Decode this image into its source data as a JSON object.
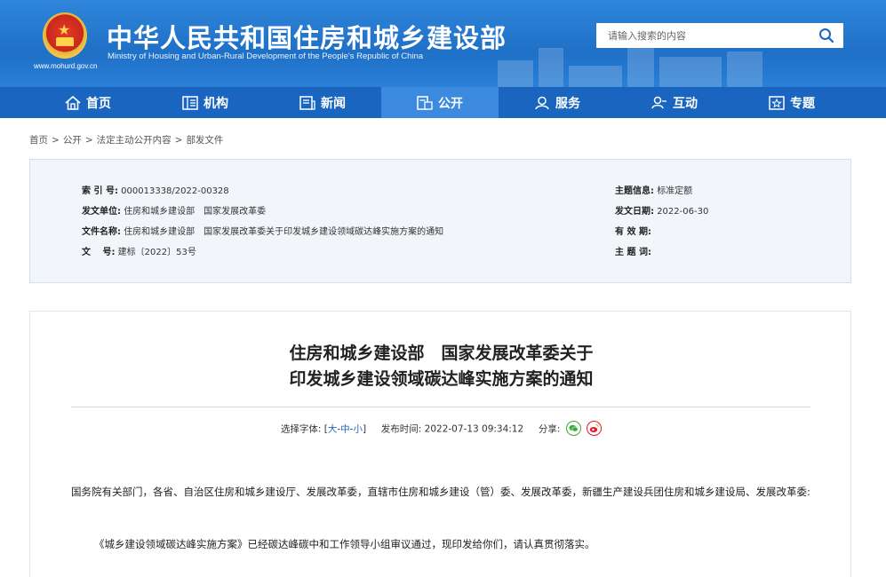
{
  "header": {
    "title_cn": "中华人民共和国住房和城乡建设部",
    "title_en": "Ministry of Housing and Urban-Rural Development of the People's Republic of China",
    "site_url": "www.mohurd.gov.cn",
    "search_placeholder": "请输入搜索的内容"
  },
  "nav": {
    "items": [
      {
        "label": "首页",
        "icon": "home-icon"
      },
      {
        "label": "机构",
        "icon": "building-icon"
      },
      {
        "label": "新闻",
        "icon": "news-icon"
      },
      {
        "label": "公开",
        "icon": "disclosure-icon"
      },
      {
        "label": "服务",
        "icon": "service-icon"
      },
      {
        "label": "互动",
        "icon": "interaction-icon"
      },
      {
        "label": "专题",
        "icon": "topic-icon"
      }
    ],
    "active_index": 3
  },
  "breadcrumb": [
    "首页",
    "公开",
    "法定主动公开内容",
    "部发文件"
  ],
  "info": {
    "index_label": "索 引 号:",
    "index_value": "000013338/2022-00328",
    "unit_label": "发文单位:",
    "unit_value": "住房和城乡建设部　国家发展改革委",
    "name_label": "文件名称:",
    "name_value": "住房和城乡建设部　国家发展改革委关于印发城乡建设领域碳达峰实施方案的通知",
    "docno_label": "文　 号:",
    "docno_value": "建标〔2022〕53号",
    "topic_label": "主题信息:",
    "topic_value": "标准定额",
    "date_label": "发文日期:",
    "date_value": "2022-06-30",
    "valid_label": "有 效 期:",
    "valid_value": "",
    "keywords_label": "主 题 词:",
    "keywords_value": ""
  },
  "article": {
    "title_line1": "住房和城乡建设部　国家发展改革委关于",
    "title_line2": "印发城乡建设领域碳达峰实施方案的通知",
    "font_label": "选择字体:",
    "font_open": "[",
    "font_large": "大",
    "font_medium": "中",
    "font_small": "小",
    "font_close": "]",
    "dash": "-",
    "publish_label": "发布时间:",
    "publish_time": "2022-07-13 09:34:12",
    "share_label": "分享:",
    "para1": "国务院有关部门，各省、自治区住房和城乡建设厅、发展改革委，直辖市住房和城乡建设（管）委、发展改革委，新疆生产建设兵团住房和城乡建设局、发展改革委:",
    "para2": "《城乡建设领域碳达峰实施方案》已经碳达峰碳中和工作领导小组审议通过，现印发给你们，请认真贯彻落实。"
  },
  "colors": {
    "header_blue": "#2a7fd6",
    "nav_blue": "#1a65c0",
    "nav_active": "#3b8ae0",
    "link_blue": "#1a65c0",
    "wechat_green": "#3aaa35",
    "weibo_red": "#e6162d"
  }
}
